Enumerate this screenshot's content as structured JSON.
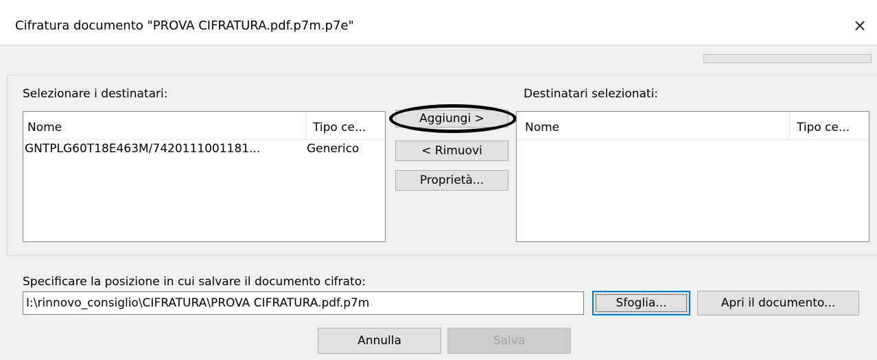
{
  "window": {
    "title": "Cifratura documento \"PROVA CIFRATURA.pdf.p7m.p7e\"",
    "close_icon": "×"
  },
  "progress": {
    "value": 0
  },
  "recipients": {
    "available_label": "Selezionare i destinatari:",
    "selected_label": "Destinatari selezionati:",
    "columns": [
      "Nome",
      "Tipo ce..."
    ],
    "available_rows": [
      {
        "name": "GNTPLG60T18E463M/7420111001181...",
        "type": "Generico"
      }
    ],
    "selected_rows": []
  },
  "actions": {
    "add": "Aggiungi >",
    "remove": "< Rimuovi",
    "properties": "Proprietà..."
  },
  "save_location": {
    "label": "Specificare la posizione in cui salvare il documento cifrato:",
    "path": "I:\\rinnovo_consiglio\\CIFRATURA\\PROVA CIFRATURA.pdf.p7m",
    "browse": "Sfoglia...",
    "open": "Apri il documento..."
  },
  "footer": {
    "cancel": "Annulla",
    "save": "Salva"
  },
  "colors": {
    "accent": "#0078d7",
    "annotation": "#000000"
  }
}
